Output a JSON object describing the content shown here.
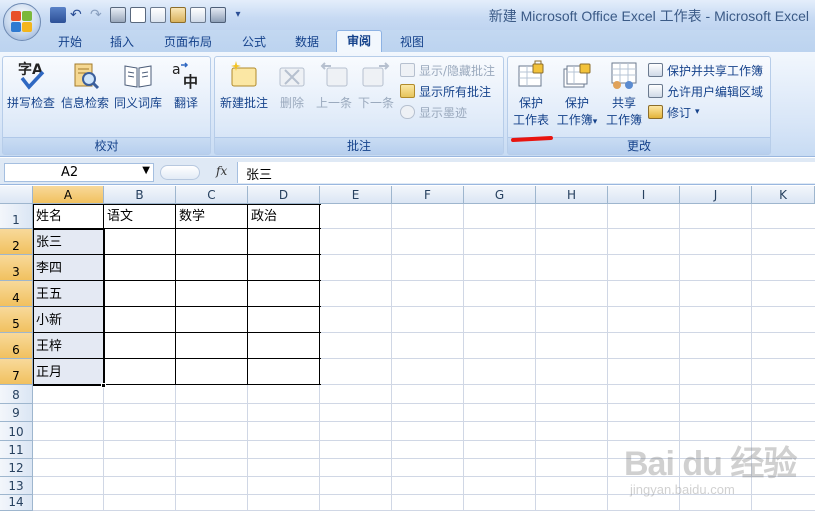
{
  "window": {
    "title": "新建 Microsoft Office Excel 工作表 - Microsoft Excel"
  },
  "qat": {
    "icons": [
      "save-icon",
      "undo-icon",
      "redo-icon",
      "print-icon",
      "print-preview-icon",
      "macro-icon",
      "form-icon",
      "chart-icon",
      "find-icon",
      "customize-qat-icon"
    ]
  },
  "tabs": [
    {
      "label": "开始"
    },
    {
      "label": "插入"
    },
    {
      "label": "页面布局"
    },
    {
      "label": "公式"
    },
    {
      "label": "数据"
    },
    {
      "label": "审阅",
      "active": true
    },
    {
      "label": "视图"
    }
  ],
  "ribbon": {
    "proofing": {
      "label": "校对",
      "buttons": [
        {
          "label": "拼写检查",
          "icon": "spelling-icon"
        },
        {
          "label": "信息检索",
          "icon": "research-icon"
        },
        {
          "label": "同义词库",
          "icon": "thesaurus-icon"
        },
        {
          "label": "翻译",
          "icon": "translate-icon"
        }
      ]
    },
    "comments": {
      "label": "批注",
      "buttons": [
        {
          "label": "新建批注",
          "icon": "new-comment-icon",
          "enabled": true
        },
        {
          "label": "删除",
          "icon": "delete-comment-icon",
          "enabled": false
        },
        {
          "label": "上一条",
          "icon": "previous-comment-icon",
          "enabled": false
        },
        {
          "label": "下一条",
          "icon": "next-comment-icon",
          "enabled": false
        }
      ],
      "small": [
        {
          "label": "显示/隐藏批注",
          "icon": "show-hide-comment-icon",
          "enabled": false
        },
        {
          "label": "显示所有批注",
          "icon": "show-all-comments-icon",
          "enabled": true
        },
        {
          "label": "显示墨迹",
          "icon": "show-ink-icon",
          "enabled": false
        }
      ]
    },
    "changes": {
      "label": "更改",
      "buttons": [
        {
          "label_line1": "保护",
          "label_line2": "工作表",
          "icon": "protect-sheet-icon"
        },
        {
          "label_line1": "保护",
          "label_line2": "工作簿",
          "icon": "protect-workbook-icon",
          "dropdown": true
        },
        {
          "label_line1": "共享",
          "label_line2": "工作簿",
          "icon": "share-workbook-icon"
        }
      ],
      "small": [
        {
          "label": "保护并共享工作簿",
          "icon": "protect-share-icon"
        },
        {
          "label": "允许用户编辑区域",
          "icon": "allow-edit-ranges-icon"
        },
        {
          "label": "修订",
          "icon": "track-changes-icon",
          "dropdown": true
        }
      ]
    }
  },
  "formula_bar": {
    "name_box": "A2",
    "fx": "fx",
    "content": "张三"
  },
  "sheet": {
    "columns": [
      "A",
      "B",
      "C",
      "D",
      "E",
      "F",
      "G",
      "H",
      "I",
      "J",
      "K"
    ],
    "rows": [
      "1",
      "2",
      "3",
      "4",
      "5",
      "6",
      "7",
      "8",
      "9",
      "10",
      "11",
      "12",
      "13",
      "14"
    ],
    "selected_column": "A",
    "selected_rows": [
      "2",
      "3",
      "4",
      "5",
      "6",
      "7"
    ],
    "active_cell": "A2",
    "headers": [
      "姓名",
      "语文",
      "数学",
      "政治"
    ],
    "names": [
      "张三",
      "李四",
      "王五",
      "小新",
      "王梓",
      "正月"
    ]
  },
  "watermark": {
    "logo": "Bai du 经验",
    "sub": "jingyan.baidu.com"
  },
  "colors": {
    "accent": "#e8140f",
    "ribbon_text": "#15428b",
    "selection": "#f1c15f"
  }
}
